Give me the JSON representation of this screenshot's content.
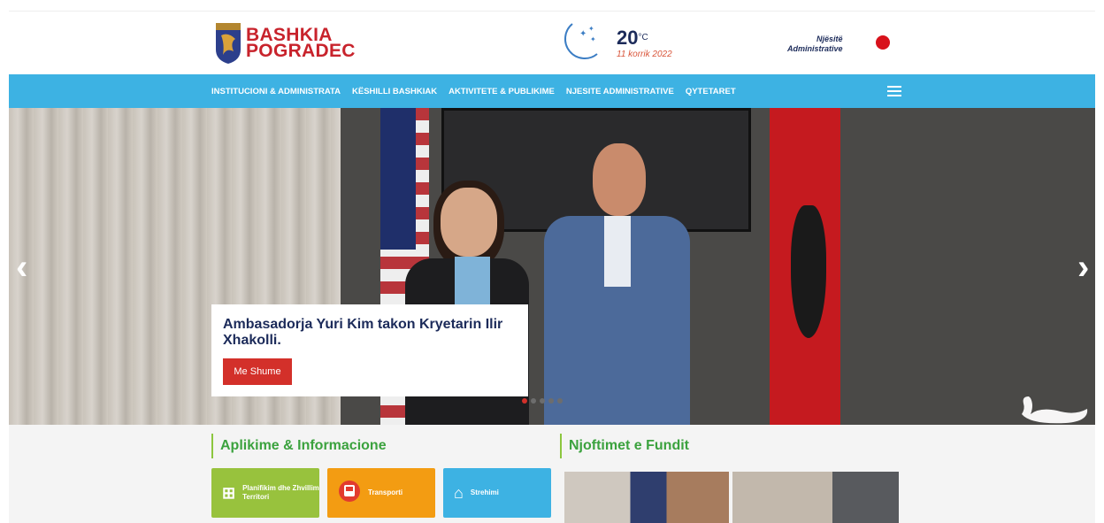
{
  "header": {
    "logo_line1": "BASHKIA",
    "logo_line2": "POGRADEC",
    "weather_temp": "20",
    "weather_unit": "°C",
    "weather_date": "11 korrik 2022",
    "njesite_line1": "Njësitë",
    "njesite_line2": "Administrative"
  },
  "nav": {
    "items": [
      "INSTITUCIONI & ADMINISTRATA",
      "KËSHILLI BASHKIAK",
      "AKTIVITETE & PUBLIKIME",
      "NJESITE ADMINISTRATIVE",
      "QYTETARET"
    ]
  },
  "hero": {
    "caption_title": "Ambasadorja Yuri Kim takon Kryetarin Ilir Xhakolli.",
    "button_label": "Me Shume"
  },
  "sections": {
    "apps_title": "Aplikime & Informacione",
    "news_title": "Njoftimet e Fundit",
    "tiles": [
      {
        "label": "Planifikim dhe Zhvillim Territori",
        "icon": "map-icon"
      },
      {
        "label": "Transporti",
        "icon": "bus-icon"
      },
      {
        "label": "Strehimi",
        "icon": "housing-icon"
      }
    ]
  },
  "colors": {
    "nav_bg": "#3db2e3",
    "brand_red": "#c8232c",
    "button_red": "#d3302a",
    "title_green": "#3ba23e"
  }
}
